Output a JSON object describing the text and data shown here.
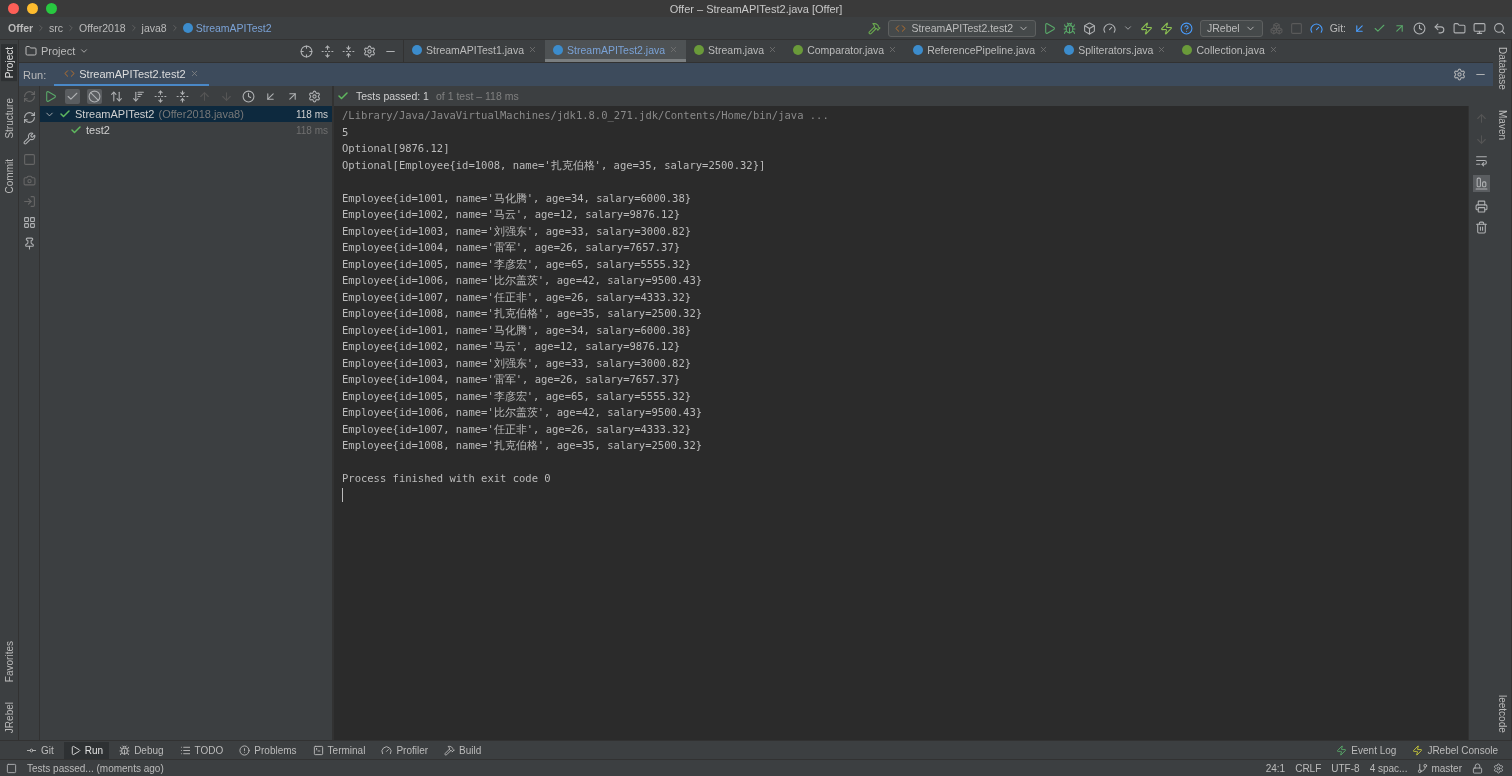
{
  "window": {
    "title": "Offer – StreamAPITest2.java [Offer]"
  },
  "breadcrumbs": [
    "Offer",
    "src",
    "Offer2018",
    "java8",
    "StreamAPITest2"
  ],
  "run_config": {
    "label": "StreamAPITest2.test2"
  },
  "plugin_dropdown": {
    "label": "JRebel"
  },
  "git_label": "Git:",
  "project_panel": {
    "label": "Project"
  },
  "editor_tabs": [
    {
      "label": "StreamAPITest1.java",
      "kind": "class",
      "selected": false
    },
    {
      "label": "StreamAPITest2.java",
      "kind": "class",
      "selected": true
    },
    {
      "label": "Stream.java",
      "kind": "interface",
      "selected": false
    },
    {
      "label": "Comparator.java",
      "kind": "interface",
      "selected": false
    },
    {
      "label": "ReferencePipeline.java",
      "kind": "class",
      "selected": false
    },
    {
      "label": "Spliterators.java",
      "kind": "class",
      "selected": false
    },
    {
      "label": "Collection.java",
      "kind": "interface",
      "selected": false
    }
  ],
  "left_stripe": {
    "top": [
      {
        "label": "Project",
        "selected": true
      },
      {
        "label": "Structure",
        "selected": false
      },
      {
        "label": "Commit",
        "selected": false
      }
    ],
    "bottom": [
      {
        "label": "Favorites",
        "selected": false
      },
      {
        "label": "JRebel",
        "selected": false
      }
    ]
  },
  "right_stripe": {
    "top": [
      {
        "label": "Database",
        "selected": false
      },
      {
        "label": "Maven",
        "selected": false
      }
    ],
    "bottom": [
      {
        "label": "leetcode",
        "selected": false
      }
    ]
  },
  "run_panel": {
    "label": "Run:",
    "tab": "StreamAPITest2.test2",
    "test_status": "Tests passed: 1",
    "test_detail": "of 1 test – 118 ms"
  },
  "test_tree": [
    {
      "label": "StreamAPITest2",
      "detail": "(Offer2018.java8)",
      "time": "118 ms",
      "passed": true,
      "expanded": true,
      "selected": true,
      "children": [
        {
          "label": "test2",
          "time": "118 ms",
          "passed": true,
          "selected": false
        }
      ]
    }
  ],
  "console": {
    "blocks": [
      [
        "/Library/Java/JavaVirtualMachines/jdk1.8.0_271.jdk/Contents/Home/bin/java ...",
        "5",
        "Optional[9876.12]",
        "Optional[Employee{id=1008, name='扎克伯格', age=35, salary=2500.32}]"
      ],
      [
        "Employee{id=1001, name='马化腾', age=34, salary=6000.38}",
        "Employee{id=1002, name='马云', age=12, salary=9876.12}",
        "Employee{id=1003, name='刘强东', age=33, salary=3000.82}",
        "Employee{id=1004, name='雷军', age=26, salary=7657.37}",
        "Employee{id=1005, name='李彦宏', age=65, salary=5555.32}",
        "Employee{id=1006, name='比尔盖茨', age=42, salary=9500.43}",
        "Employee{id=1007, name='任正非', age=26, salary=4333.32}",
        "Employee{id=1008, name='扎克伯格', age=35, salary=2500.32}",
        "Employee{id=1001, name='马化腾', age=34, salary=6000.38}",
        "Employee{id=1002, name='马云', age=12, salary=9876.12}",
        "Employee{id=1003, name='刘强东', age=33, salary=3000.82}",
        "Employee{id=1004, name='雷军', age=26, salary=7657.37}",
        "Employee{id=1005, name='李彦宏', age=65, salary=5555.32}",
        "Employee{id=1006, name='比尔盖茨', age=42, salary=9500.43}",
        "Employee{id=1007, name='任正非', age=26, salary=4333.32}",
        "Employee{id=1008, name='扎克伯格', age=35, salary=2500.32}"
      ],
      [
        "Process finished with exit code 0"
      ]
    ]
  },
  "tool_tabs": [
    {
      "label": "Git",
      "kind": "git",
      "selected": false
    },
    {
      "label": "Run",
      "kind": "run",
      "selected": true
    },
    {
      "label": "Debug",
      "kind": "debug",
      "selected": false
    },
    {
      "label": "TODO",
      "kind": "todo",
      "selected": false
    },
    {
      "label": "Problems",
      "kind": "problems",
      "selected": false
    },
    {
      "label": "Terminal",
      "kind": "terminal",
      "selected": false
    },
    {
      "label": "Profiler",
      "kind": "profiler",
      "selected": false
    },
    {
      "label": "Build",
      "kind": "build",
      "selected": false
    }
  ],
  "right_tool_tabs": [
    {
      "label": "Event Log",
      "kind": "log"
    },
    {
      "label": "JRebel Console",
      "kind": "jrebel"
    }
  ],
  "status_bar": {
    "message": "Tests passed... (moments ago)",
    "position": "24:1",
    "line_ending": "CRLF",
    "encoding": "UTF-8",
    "indent": "4 spac...",
    "branch": "master"
  }
}
